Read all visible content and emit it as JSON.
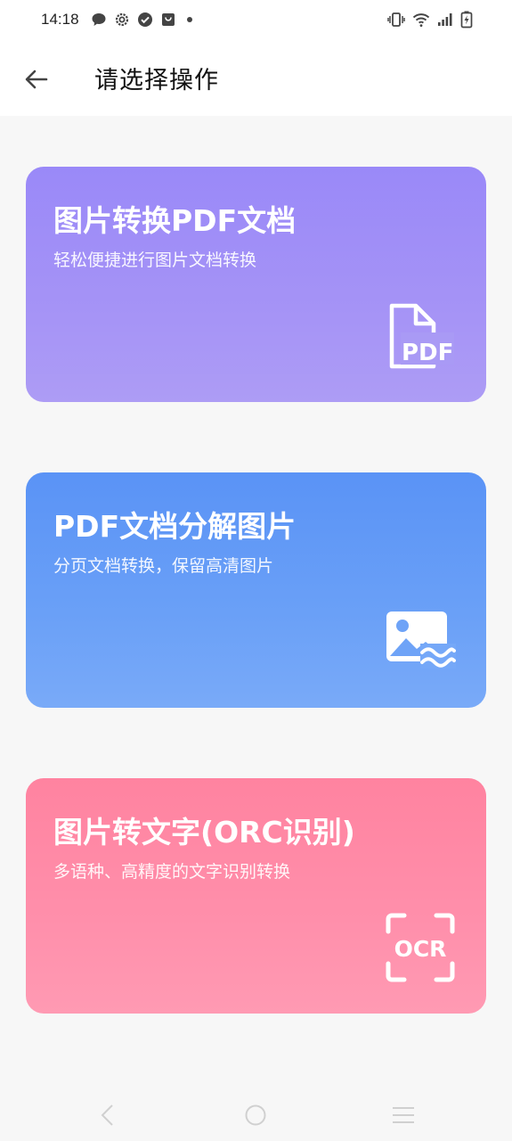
{
  "status_bar": {
    "time": "14:18",
    "icons_left": [
      "chat-bubble-icon",
      "settings-gear-icon",
      "check-circle-icon",
      "shopping-bag-icon",
      "dot-icon"
    ],
    "icons_right": [
      "vibrate-icon",
      "wifi-icon",
      "signal-icon",
      "battery-charging-icon"
    ]
  },
  "header": {
    "title": "请选择操作",
    "back_icon": "arrow-left-icon"
  },
  "cards": [
    {
      "title": "图片转换PDF文档",
      "subtitle": "轻松便捷进行图片文档转换",
      "icon": "pdf-file-icon",
      "icon_text": "PDF",
      "color": "#9a89f8"
    },
    {
      "title": "PDF文档分解图片",
      "subtitle": "分页文档转换，保留高清图片",
      "icon": "image-icon",
      "color": "#5a93f6"
    },
    {
      "title": "图片转文字(ORC识别)",
      "subtitle": "多语种、高精度的文字识别转换",
      "icon": "ocr-scan-icon",
      "icon_text": "OCR",
      "color": "#ff83a0"
    }
  ],
  "nav_bar": {
    "items": [
      "nav-back-icon",
      "nav-home-icon",
      "nav-menu-icon"
    ]
  }
}
